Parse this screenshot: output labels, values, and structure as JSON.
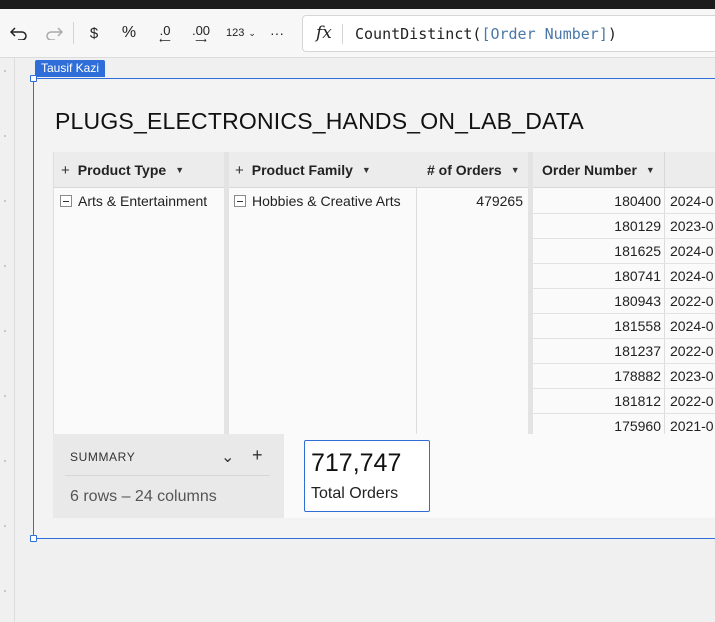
{
  "toolbar": {
    "undo_icon": "undo-icon",
    "redo_icon": "redo-icon",
    "currency_label": "$",
    "percent_label": "%",
    "decrease_decimals_label": ".0",
    "increase_decimals_label": ".00",
    "number_format_label": "123",
    "more_label": "···"
  },
  "formula_bar": {
    "fx_label": "fx",
    "function_text": "CountDistinct(",
    "reference_text": "[Order Number]",
    "closing_text": ")"
  },
  "element": {
    "owner_tag": "Tausif Kazi",
    "title": "PLUGS_ELECTRONICS_HANDS_ON_LAB_DATA",
    "accent_color": "#2f6ed8"
  },
  "table": {
    "columns": [
      {
        "label": "Product Type"
      },
      {
        "label": "Product Family"
      },
      {
        "label": "# of Orders"
      },
      {
        "label": "Order Number"
      }
    ],
    "group": {
      "product_type": "Arts & Entertainment",
      "product_family": "Hobbies & Creative Arts",
      "orders": "479265"
    },
    "rows": [
      {
        "order_number": "180400",
        "date": "2024-0"
      },
      {
        "order_number": "180129",
        "date": "2023-0"
      },
      {
        "order_number": "181625",
        "date": "2024-0"
      },
      {
        "order_number": "180741",
        "date": "2024-0"
      },
      {
        "order_number": "180943",
        "date": "2022-0"
      },
      {
        "order_number": "181558",
        "date": "2024-0"
      },
      {
        "order_number": "181237",
        "date": "2022-0"
      },
      {
        "order_number": "178882",
        "date": "2023-0"
      },
      {
        "order_number": "181812",
        "date": "2022-0"
      },
      {
        "order_number": "175960",
        "date": "2021-0"
      }
    ]
  },
  "summary": {
    "label": "SUMMARY",
    "rows_text": "6 rows – 24 columns",
    "metric_value": "717,747",
    "metric_label": "Total Orders"
  }
}
